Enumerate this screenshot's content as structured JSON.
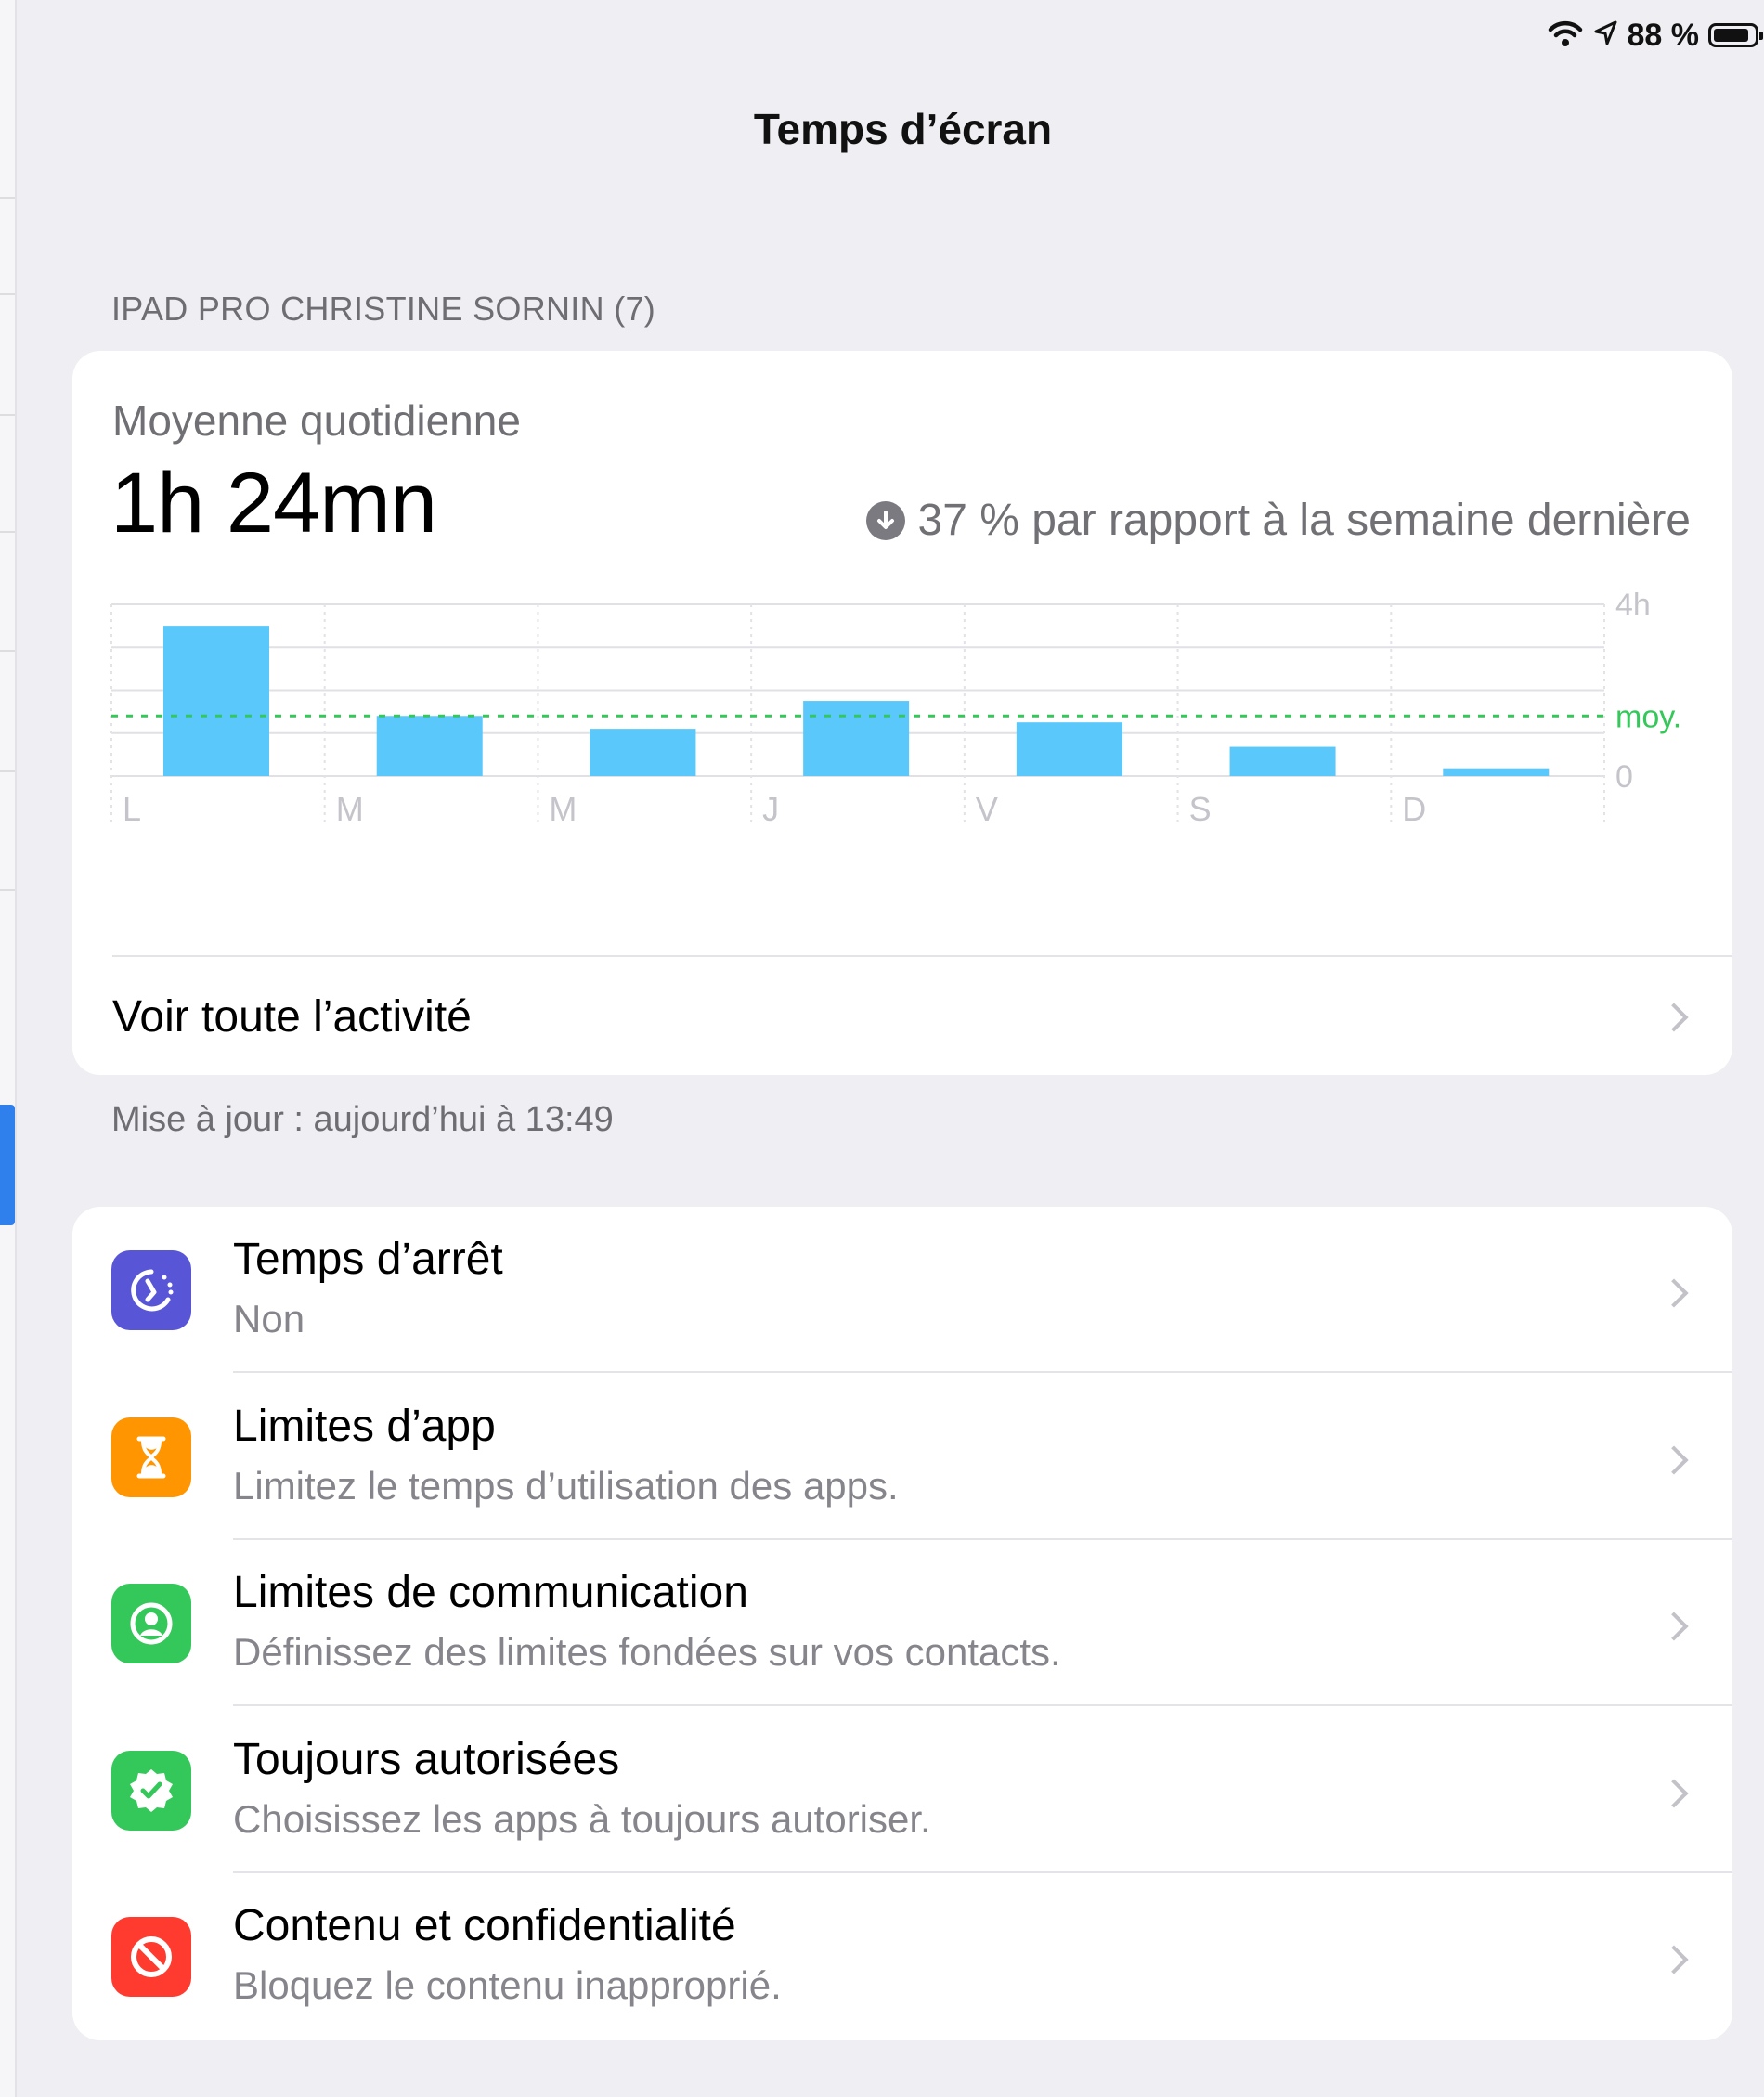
{
  "status_bar": {
    "battery_text": "88 %",
    "battery_level": 0.88
  },
  "nav": {
    "title": "Temps d’écran"
  },
  "device_section": {
    "header": "IPAD PRO CHRISTINE SORNIN (7)"
  },
  "summary": {
    "label": "Moyenne quotidienne",
    "value": "1h 24mn",
    "change_text": "37 % par rapport à la semaine dernière",
    "change_direction": "down",
    "see_all_label": "Voir toute l’activité"
  },
  "chart_data": {
    "type": "bar",
    "categories": [
      "L",
      "M",
      "M",
      "J",
      "V",
      "S",
      "D"
    ],
    "values": [
      3.5,
      1.4,
      1.1,
      1.75,
      1.25,
      0.68,
      0.18
    ],
    "units": "h",
    "ylim": [
      0,
      4
    ],
    "y_tick_labels": [
      "4h",
      "0"
    ],
    "average": 1.4,
    "average_label": "moy.",
    "bar_color": "#5ac8fa",
    "average_color": "#34c759",
    "grid": true
  },
  "update_note": "Mise à jour : aujourd’hui à 13:49",
  "menu": [
    {
      "title": "Temps d’arrêt",
      "subtitle": "Non",
      "icon": "downtime-icon",
      "color": "#5856d6"
    },
    {
      "title": "Limites d’app",
      "subtitle": "Limitez le temps d’utilisation des apps.",
      "icon": "hourglass-icon",
      "color": "#ff9500"
    },
    {
      "title": "Limites de communication",
      "subtitle": "Définissez des limites fondées sur vos contacts.",
      "icon": "contact-icon",
      "color": "#34c759"
    },
    {
      "title": "Toujours autorisées",
      "subtitle": "Choisissez les apps à toujours autoriser.",
      "icon": "checkmark-badge-icon",
      "color": "#34c759"
    },
    {
      "title": "Contenu et confidentialité",
      "subtitle": "Bloquez le contenu inapproprié.",
      "icon": "restricted-icon",
      "color": "#ff3b30"
    }
  ]
}
